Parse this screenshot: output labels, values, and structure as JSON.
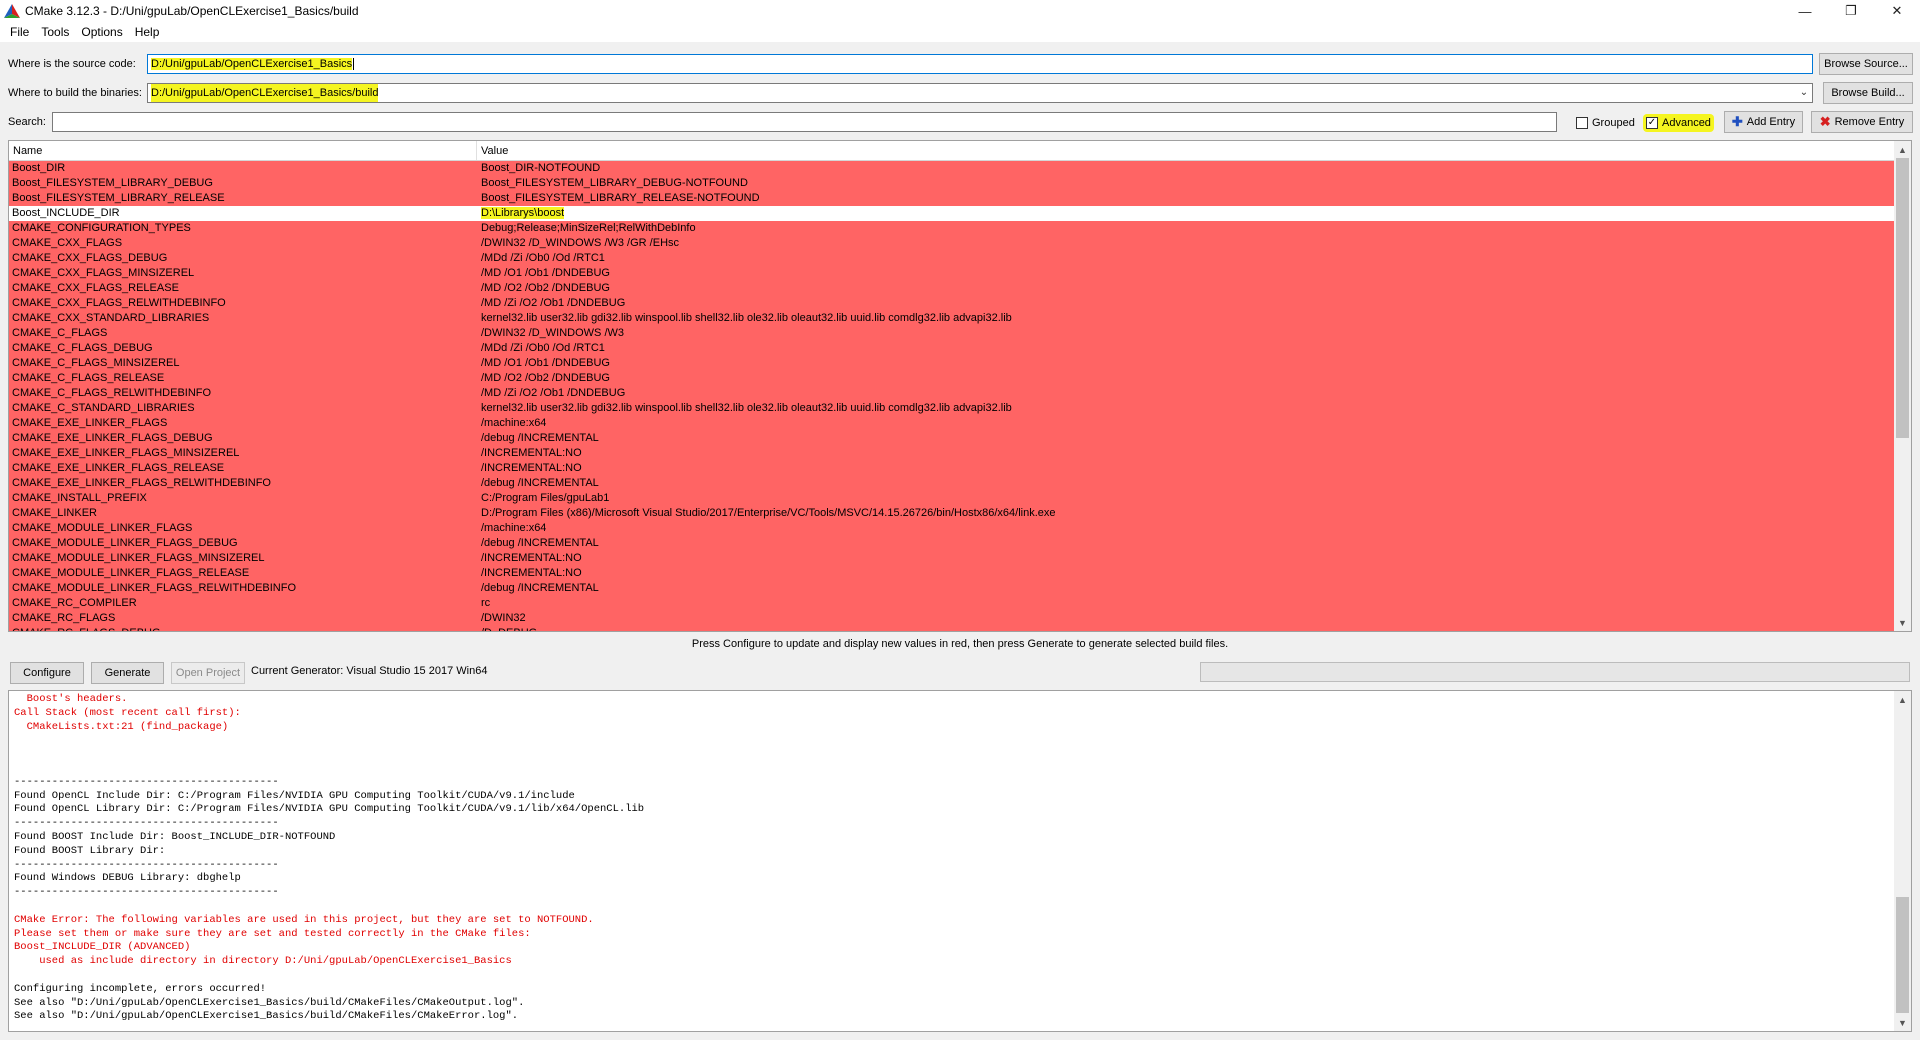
{
  "window": {
    "title": "CMake 3.12.3 - D:/Uni/gpuLab/OpenCLExercise1_Basics/build",
    "minimize_icon": "minimize-icon",
    "maximize_icon": "maximize-icon",
    "close_icon": "close-icon"
  },
  "menu": [
    "File",
    "Tools",
    "Options",
    "Help"
  ],
  "source": {
    "label": "Where is the source code:",
    "value": "D:/Uni/gpuLab/OpenCLExercise1_Basics",
    "browse_label": "Browse Source..."
  },
  "binaries": {
    "label": "Where to build the binaries:",
    "value": "D:/Uni/gpuLab/OpenCLExercise1_Basics/build",
    "browse_label": "Browse Build..."
  },
  "search": {
    "label": "Search:",
    "value": ""
  },
  "options": {
    "grouped_label": "Grouped",
    "grouped_checked": false,
    "advanced_label": "Advanced",
    "advanced_checked": true,
    "add_entry_label": "Add Entry",
    "remove_entry_label": "Remove Entry"
  },
  "table": {
    "headers": [
      "Name",
      "Value"
    ],
    "rows": [
      {
        "name": "Boost_DIR",
        "value": "Boost_DIR-NOTFOUND",
        "selected": false
      },
      {
        "name": "Boost_FILESYSTEM_LIBRARY_DEBUG",
        "value": "Boost_FILESYSTEM_LIBRARY_DEBUG-NOTFOUND",
        "selected": false
      },
      {
        "name": "Boost_FILESYSTEM_LIBRARY_RELEASE",
        "value": "Boost_FILESYSTEM_LIBRARY_RELEASE-NOTFOUND",
        "selected": false
      },
      {
        "name": "Boost_INCLUDE_DIR",
        "value": "D:\\Librarys\\boost",
        "selected": true
      },
      {
        "name": "CMAKE_CONFIGURATION_TYPES",
        "value": "Debug;Release;MinSizeRel;RelWithDebInfo",
        "selected": false
      },
      {
        "name": "CMAKE_CXX_FLAGS",
        "value": "/DWIN32 /D_WINDOWS /W3 /GR /EHsc",
        "selected": false
      },
      {
        "name": "CMAKE_CXX_FLAGS_DEBUG",
        "value": "/MDd /Zi /Ob0 /Od /RTC1",
        "selected": false
      },
      {
        "name": "CMAKE_CXX_FLAGS_MINSIZEREL",
        "value": "/MD /O1 /Ob1 /DNDEBUG",
        "selected": false
      },
      {
        "name": "CMAKE_CXX_FLAGS_RELEASE",
        "value": "/MD /O2 /Ob2 /DNDEBUG",
        "selected": false
      },
      {
        "name": "CMAKE_CXX_FLAGS_RELWITHDEBINFO",
        "value": "/MD /Zi /O2 /Ob1 /DNDEBUG",
        "selected": false
      },
      {
        "name": "CMAKE_CXX_STANDARD_LIBRARIES",
        "value": "kernel32.lib user32.lib gdi32.lib winspool.lib shell32.lib ole32.lib oleaut32.lib uuid.lib comdlg32.lib advapi32.lib",
        "selected": false
      },
      {
        "name": "CMAKE_C_FLAGS",
        "value": "/DWIN32 /D_WINDOWS /W3",
        "selected": false
      },
      {
        "name": "CMAKE_C_FLAGS_DEBUG",
        "value": "/MDd /Zi /Ob0 /Od /RTC1",
        "selected": false
      },
      {
        "name": "CMAKE_C_FLAGS_MINSIZEREL",
        "value": "/MD /O1 /Ob1 /DNDEBUG",
        "selected": false
      },
      {
        "name": "CMAKE_C_FLAGS_RELEASE",
        "value": "/MD /O2 /Ob2 /DNDEBUG",
        "selected": false
      },
      {
        "name": "CMAKE_C_FLAGS_RELWITHDEBINFO",
        "value": "/MD /Zi /O2 /Ob1 /DNDEBUG",
        "selected": false
      },
      {
        "name": "CMAKE_C_STANDARD_LIBRARIES",
        "value": "kernel32.lib user32.lib gdi32.lib winspool.lib shell32.lib ole32.lib oleaut32.lib uuid.lib comdlg32.lib advapi32.lib",
        "selected": false
      },
      {
        "name": "CMAKE_EXE_LINKER_FLAGS",
        "value": "/machine:x64",
        "selected": false
      },
      {
        "name": "CMAKE_EXE_LINKER_FLAGS_DEBUG",
        "value": "/debug /INCREMENTAL",
        "selected": false
      },
      {
        "name": "CMAKE_EXE_LINKER_FLAGS_MINSIZEREL",
        "value": "/INCREMENTAL:NO",
        "selected": false
      },
      {
        "name": "CMAKE_EXE_LINKER_FLAGS_RELEASE",
        "value": "/INCREMENTAL:NO",
        "selected": false
      },
      {
        "name": "CMAKE_EXE_LINKER_FLAGS_RELWITHDEBINFO",
        "value": "/debug /INCREMENTAL",
        "selected": false
      },
      {
        "name": "CMAKE_INSTALL_PREFIX",
        "value": "C:/Program Files/gpuLab1",
        "selected": false
      },
      {
        "name": "CMAKE_LINKER",
        "value": "D:/Program Files (x86)/Microsoft Visual Studio/2017/Enterprise/VC/Tools/MSVC/14.15.26726/bin/Hostx86/x64/link.exe",
        "selected": false
      },
      {
        "name": "CMAKE_MODULE_LINKER_FLAGS",
        "value": "/machine:x64",
        "selected": false
      },
      {
        "name": "CMAKE_MODULE_LINKER_FLAGS_DEBUG",
        "value": "/debug /INCREMENTAL",
        "selected": false
      },
      {
        "name": "CMAKE_MODULE_LINKER_FLAGS_MINSIZEREL",
        "value": "/INCREMENTAL:NO",
        "selected": false
      },
      {
        "name": "CMAKE_MODULE_LINKER_FLAGS_RELEASE",
        "value": "/INCREMENTAL:NO",
        "selected": false
      },
      {
        "name": "CMAKE_MODULE_LINKER_FLAGS_RELWITHDEBINFO",
        "value": "/debug /INCREMENTAL",
        "selected": false
      },
      {
        "name": "CMAKE_RC_COMPILER",
        "value": "rc",
        "selected": false
      },
      {
        "name": "CMAKE_RC_FLAGS",
        "value": "/DWIN32",
        "selected": false
      },
      {
        "name": "CMAKE_RC_FLAGS_DEBUG",
        "value": "/D_DEBUG",
        "selected": false
      }
    ]
  },
  "hint": "Press Configure to update and display new values in red, then press Generate to generate selected build files.",
  "actions": {
    "configure_label": "Configure",
    "generate_label": "Generate",
    "open_project_label": "Open Project",
    "current_generator": "Current Generator: Visual Studio 15 2017 Win64"
  },
  "log": [
    {
      "text": "  Boost's headers.",
      "error": true
    },
    {
      "text": "Call Stack (most recent call first):",
      "error": true
    },
    {
      "text": "  CMakeLists.txt:21 (find_package)",
      "error": true
    },
    {
      "text": "",
      "error": false
    },
    {
      "text": "",
      "error": false
    },
    {
      "text": "",
      "error": false
    },
    {
      "text": "------------------------------------------",
      "error": false
    },
    {
      "text": "Found OpenCL Include Dir: C:/Program Files/NVIDIA GPU Computing Toolkit/CUDA/v9.1/include",
      "error": false
    },
    {
      "text": "Found OpenCL Library Dir: C:/Program Files/NVIDIA GPU Computing Toolkit/CUDA/v9.1/lib/x64/OpenCL.lib",
      "error": false
    },
    {
      "text": "------------------------------------------",
      "error": false
    },
    {
      "text": "Found BOOST Include Dir: Boost_INCLUDE_DIR-NOTFOUND",
      "error": false
    },
    {
      "text": "Found BOOST Library Dir:",
      "error": false
    },
    {
      "text": "------------------------------------------",
      "error": false
    },
    {
      "text": "Found Windows DEBUG Library: dbghelp",
      "error": false
    },
    {
      "text": "------------------------------------------",
      "error": false
    },
    {
      "text": "",
      "error": false
    },
    {
      "text": "CMake Error: The following variables are used in this project, but they are set to NOTFOUND.",
      "error": true
    },
    {
      "text": "Please set them or make sure they are set and tested correctly in the CMake files:",
      "error": true
    },
    {
      "text": "Boost_INCLUDE_DIR (ADVANCED)",
      "error": true
    },
    {
      "text": "    used as include directory in directory D:/Uni/gpuLab/OpenCLExercise1_Basics",
      "error": true
    },
    {
      "text": "",
      "error": false
    },
    {
      "text": "Configuring incomplete, errors occurred!",
      "error": false
    },
    {
      "text": "See also \"D:/Uni/gpuLab/OpenCLExercise1_Basics/build/CMakeFiles/CMakeOutput.log\".",
      "error": false
    },
    {
      "text": "See also \"D:/Uni/gpuLab/OpenCLExercise1_Basics/build/CMakeFiles/CMakeError.log\".",
      "error": false
    }
  ],
  "colors": {
    "new_entry_red": "#ff6464",
    "highlight_yellow": "#f5f520",
    "log_error": "#e00000"
  }
}
